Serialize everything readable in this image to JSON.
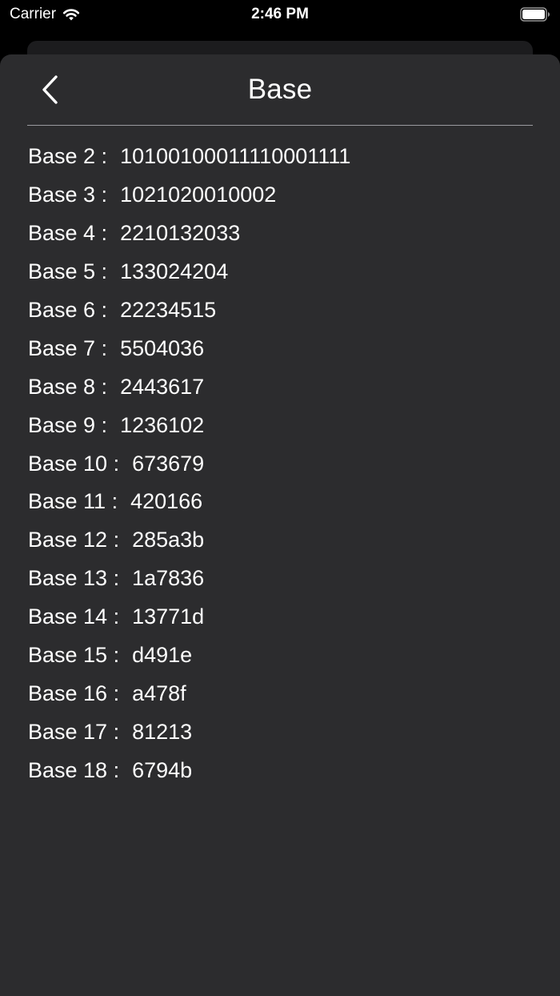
{
  "status_bar": {
    "carrier": "Carrier",
    "time": "2:46 PM"
  },
  "nav": {
    "title": "Base",
    "back_icon": "chevron-left-icon"
  },
  "bases": [
    {
      "label": "Base 2 :",
      "value": "10100100011110001111"
    },
    {
      "label": "Base 3 :",
      "value": "1021020010002"
    },
    {
      "label": "Base 4 :",
      "value": "2210132033"
    },
    {
      "label": "Base 5 :",
      "value": "133024204"
    },
    {
      "label": "Base 6 :",
      "value": "22234515"
    },
    {
      "label": "Base 7 :",
      "value": "5504036"
    },
    {
      "label": "Base 8 :",
      "value": "2443617"
    },
    {
      "label": "Base 9 :",
      "value": "1236102"
    },
    {
      "label": "Base 10 :",
      "value": "673679"
    },
    {
      "label": "Base 11 :",
      "value": "420166"
    },
    {
      "label": "Base 12 :",
      "value": "285a3b"
    },
    {
      "label": "Base 13 :",
      "value": "1a7836"
    },
    {
      "label": "Base 14 :",
      "value": "13771d"
    },
    {
      "label": "Base 15 :",
      "value": "d491e"
    },
    {
      "label": "Base 16 :",
      "value": "a478f"
    },
    {
      "label": "Base 17 :",
      "value": "81213"
    },
    {
      "label": "Base 18 :",
      "value": "6794b"
    }
  ],
  "colors": {
    "background": "#000000",
    "sheet": "#2c2c2e",
    "text": "#ffffff",
    "separator": "#9a9a9e"
  }
}
